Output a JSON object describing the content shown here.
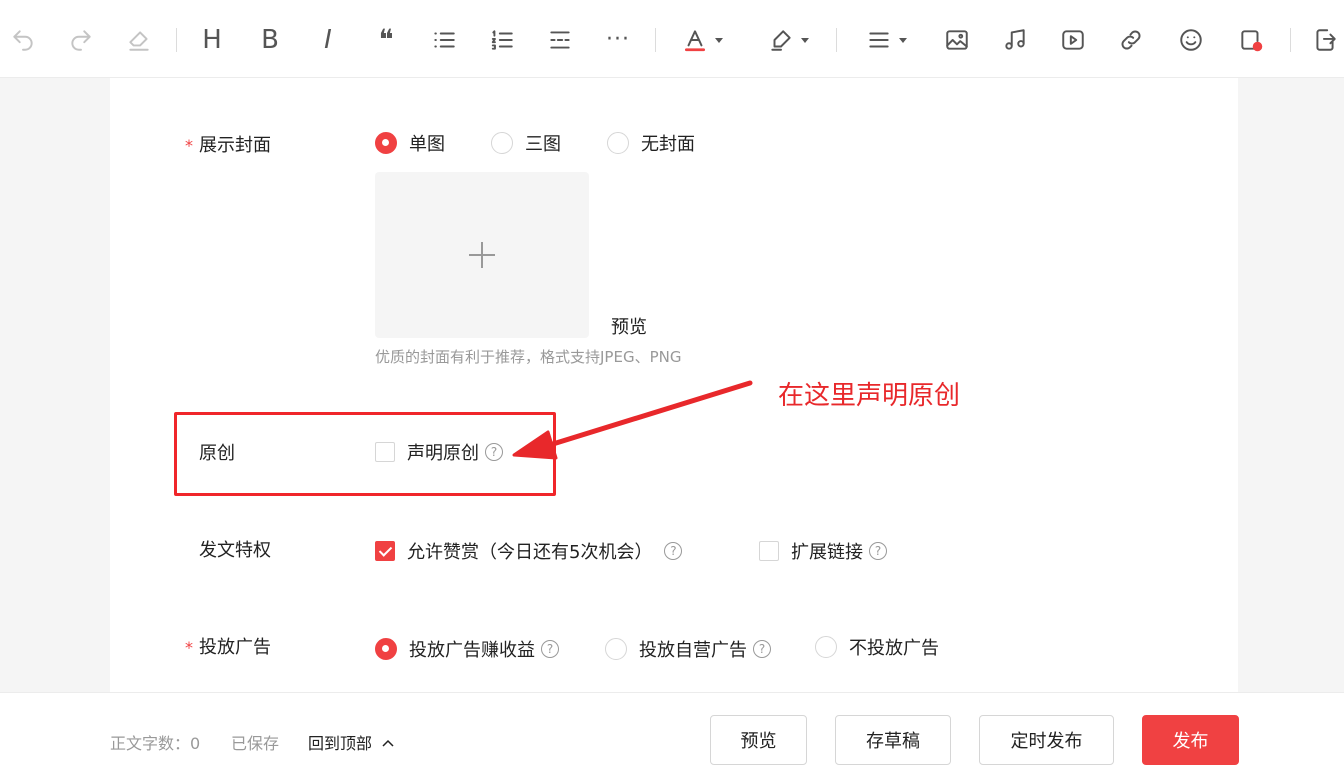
{
  "toolbar": {
    "icons": [
      "undo-icon",
      "redo-icon",
      "eraser-icon",
      "heading-icon",
      "bold-icon",
      "italic-icon",
      "quote-icon",
      "bullet-list-icon",
      "numbered-list-icon",
      "divider-icon",
      "more-icon",
      "font-color-icon",
      "highlight-icon",
      "align-icon",
      "image-icon",
      "audio-icon",
      "video-icon",
      "link-icon",
      "emoji-icon",
      "insert-card-icon",
      "import-doc-icon"
    ],
    "heading": "H",
    "bold": "B",
    "italic": "I",
    "quote": "❝",
    "more": "···"
  },
  "cover": {
    "label": "展示封面",
    "required_mark": "*",
    "options": [
      "单图",
      "三图",
      "无封面"
    ],
    "selected": "单图",
    "preview_link": "预览",
    "hint": "优质的封面有利于推荐，格式支持JPEG、PNG"
  },
  "original": {
    "label": "原创",
    "checkbox_label": "声明原创",
    "checked": false
  },
  "annotation": {
    "text": "在这里声明原创",
    "color": "#e8282b"
  },
  "privileges": {
    "label": "发文特权",
    "reward_label": "允许赞赏（今日还有5次机会）",
    "reward_checked": true,
    "extend_link_label": "扩展链接",
    "extend_link_checked": false
  },
  "ads": {
    "label": "投放广告",
    "required_mark": "*",
    "options": [
      "投放广告赚收益",
      "投放自营广告",
      "不投放广告"
    ],
    "selected": "投放广告赚收益"
  },
  "footer": {
    "word_count": "正文字数：0",
    "saved": "已保存",
    "back_to_top": "回到顶部",
    "buttons": {
      "preview": "预览",
      "draft": "存草稿",
      "schedule": "定时发布",
      "publish": "发布"
    }
  },
  "colors": {
    "accent": "#f04142",
    "hint": "#999999"
  }
}
